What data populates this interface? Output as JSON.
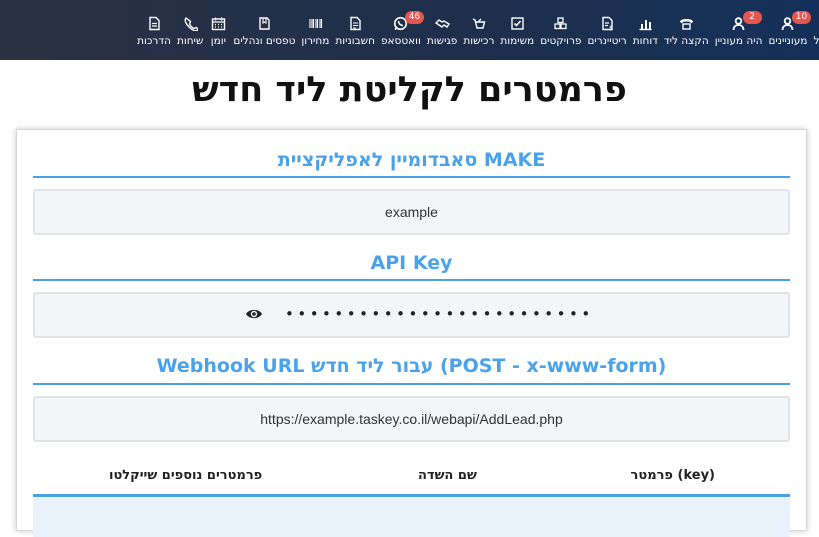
{
  "nav": {
    "items": [
      {
        "key": "treatment",
        "label": "טיפול",
        "icon": "user-plus-icon"
      },
      {
        "key": "interested",
        "label": "מעוניינים",
        "icon": "user-icon",
        "badge": "10"
      },
      {
        "key": "was_interested",
        "label": "היה מעוניין",
        "icon": "user-icon",
        "badge": "2"
      },
      {
        "key": "assign_lead",
        "label": "הקצה ליד",
        "icon": "phone-icon"
      },
      {
        "key": "reports",
        "label": "דוחות",
        "icon": "bar-chart-icon"
      },
      {
        "key": "retainers",
        "label": "ריטיינרים",
        "icon": "invoice-icon"
      },
      {
        "key": "projects",
        "label": "פרויקטים",
        "icon": "cubes-icon"
      },
      {
        "key": "tasks",
        "label": "משימות",
        "icon": "check-square-icon"
      },
      {
        "key": "purchases",
        "label": "רכישות",
        "icon": "cart-icon"
      },
      {
        "key": "meetings",
        "label": "פגישות",
        "icon": "handshake-icon"
      },
      {
        "key": "whatsapp",
        "label": "וואטסאפ",
        "icon": "whatsapp-icon",
        "badge": "46"
      },
      {
        "key": "invoices",
        "label": "חשבוניות",
        "icon": "document-icon"
      },
      {
        "key": "pricelist",
        "label": "מחירון",
        "icon": "barcode-icon"
      },
      {
        "key": "tips",
        "label": "טפסים ונהלים",
        "icon": "forms-icon"
      },
      {
        "key": "calendar",
        "label": "יומן",
        "icon": "calendar-icon"
      },
      {
        "key": "calls",
        "label": "שיחות",
        "icon": "phone-call-icon"
      },
      {
        "key": "training",
        "label": "הדרכות",
        "icon": "file-icon"
      }
    ]
  },
  "page": {
    "title": "פרמטרים לקליטת ליד חדש"
  },
  "sections": {
    "subdomain": {
      "heading": "סאבדומיין לאפליקציית MAKE",
      "value": "example"
    },
    "api_key": {
      "heading": "API Key",
      "value": "•••••••••••••••••••••••••"
    },
    "webhook": {
      "heading": "Webhook URL עבור ליד חדש (POST - x-www-form)",
      "value": "https://example.taskey.co.il/webapi/AddLead.php"
    }
  },
  "table": {
    "headers": [
      "פרמטר (key)",
      "שם השדה",
      "פרמטרים נוספים שייקלטו"
    ]
  },
  "colors": {
    "nav_bg": "#1d2f4d",
    "accent": "#4aa3ea",
    "badge": "#e8554e"
  }
}
